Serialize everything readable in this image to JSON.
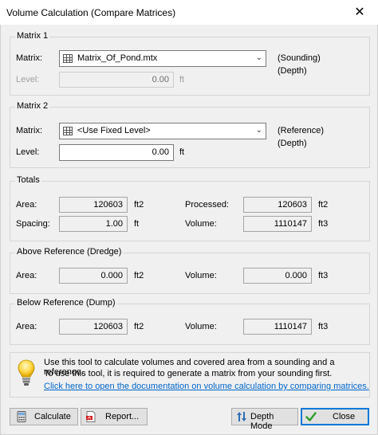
{
  "window": {
    "title": "Volume Calculation (Compare Matrices)",
    "close_glyph": "✕"
  },
  "matrix1": {
    "group_title": "Matrix 1",
    "matrix_label": "Matrix:",
    "matrix_value": "Matrix_Of_Pond.mtx",
    "matrix_icon": "grid-icon",
    "role_line1": "(Sounding)",
    "role_line2": "(Depth)",
    "level_label": "Level:",
    "level_value": "0.00",
    "level_unit": "ft"
  },
  "matrix2": {
    "group_title": "Matrix 2",
    "matrix_label": "Matrix:",
    "matrix_value": "<Use Fixed Level>",
    "matrix_icon": "grid-icon",
    "role_line1": "(Reference)",
    "role_line2": "(Depth)",
    "level_label": "Level:",
    "level_value": "0.00",
    "level_unit": "ft"
  },
  "totals": {
    "group_title": "Totals",
    "area_label": "Area:",
    "area_value": "120603",
    "area_unit": "ft2",
    "processed_label": "Processed:",
    "processed_value": "120603",
    "processed_unit": "ft2",
    "spacing_label": "Spacing:",
    "spacing_value": "1.00",
    "spacing_unit": "ft",
    "volume_label": "Volume:",
    "volume_value": "1110147",
    "volume_unit": "ft3"
  },
  "above": {
    "group_title": "Above Reference (Dredge)",
    "area_label": "Area:",
    "area_value": "0.000",
    "area_unit": "ft2",
    "volume_label": "Volume:",
    "volume_value": "0.000",
    "volume_unit": "ft3"
  },
  "below": {
    "group_title": "Below Reference (Dump)",
    "area_label": "Area:",
    "area_value": "120603",
    "area_unit": "ft2",
    "volume_label": "Volume:",
    "volume_value": "1110147",
    "volume_unit": "ft3"
  },
  "info": {
    "line1": "Use this tool to calculate volumes and covered area from a sounding and a reference.",
    "line2": "To use this tool, it is required to generate a matrix from your sounding first.",
    "link": "Click here to open the documentation on volume calculation by comparing matrices."
  },
  "buttons": {
    "calculate": "Calculate",
    "report": "Report...",
    "depth_mode": "Depth Mode",
    "close": "Close"
  },
  "colors": {
    "link": "#0066cc",
    "accent": "#0078d7",
    "check": "#2e9e2e"
  }
}
